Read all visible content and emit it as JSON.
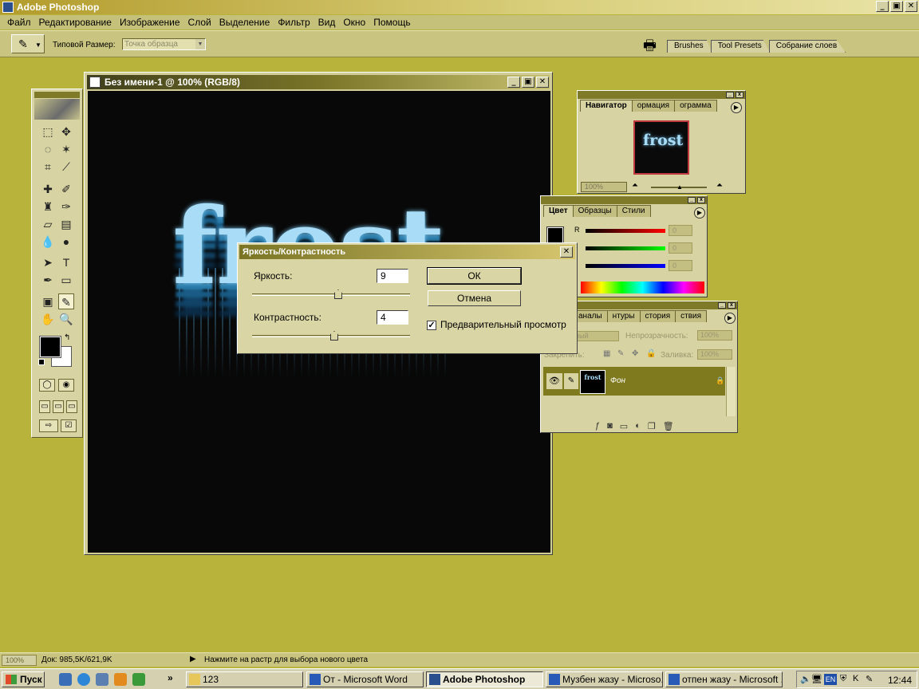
{
  "app": {
    "title": "Adobe Photoshop"
  },
  "window_controls": {
    "minimize": "_",
    "restore": "▣",
    "close": "✕"
  },
  "menu": [
    "Файл",
    "Редактирование",
    "Изображение",
    "Слой",
    "Выделение",
    "Фильтр",
    "Вид",
    "Окно",
    "Помощь"
  ],
  "options_bar": {
    "sample_size_label": "Типовой Размер:",
    "sample_size_value": "Точка образца",
    "palette_well_tabs": [
      "Brushes",
      "Tool Presets",
      "Собрание слоев"
    ]
  },
  "toolbox": {
    "icons": [
      "marquee-icon",
      "move-icon",
      "lasso-icon",
      "magic-wand-icon",
      "crop-icon",
      "slice-icon",
      "healing-icon",
      "brush-icon",
      "stamp-icon",
      "history-brush-icon",
      "eraser-icon",
      "gradient-icon",
      "blur-icon",
      "dodge-icon",
      "path-select-icon",
      "type-icon",
      "pen-icon",
      "shape-icon",
      "notes-icon",
      "eyedropper-icon",
      "hand-icon",
      "zoom-icon"
    ],
    "active_tool": "eyedropper-icon",
    "foreground_color": "#000000",
    "background_color": "#ffffff"
  },
  "document": {
    "title": "Без имени-1 @ 100% (RGB/8)",
    "artwork_text": "frost"
  },
  "navigator": {
    "tabs": [
      "Навигатор",
      "ормация",
      "ограмма"
    ],
    "zoom": "100%",
    "thumb_text": "frost"
  },
  "color_palette": {
    "tabs": [
      "Цвет",
      "Образцы",
      "Стили"
    ],
    "r_label": "R",
    "r_value": "0",
    "g_value": "0",
    "b_value": "0"
  },
  "layers_palette": {
    "tabs": [
      "аналы",
      "нтуры",
      "стория",
      "ствия"
    ],
    "blend_mode": "ный",
    "opacity_label": "Непрозрачность:",
    "opacity_value": "100%",
    "lock_label": "Закрепить:",
    "fill_label": "Заливка:",
    "fill_value": "100%",
    "layer_name": "Фон",
    "layer_thumb_text": "frost"
  },
  "dialog": {
    "title": "Яркость/Контрастность",
    "brightness_label": "Яркость:",
    "brightness_value": "9",
    "contrast_label": "Контрастность:",
    "contrast_value": "4",
    "brightness_level": 9,
    "contrast_level": 4,
    "ok_label": "ОК",
    "cancel_label": "Отмена",
    "preview_label": "Предварительный просмотр",
    "preview_checked": true
  },
  "status_bar": {
    "zoom": "100%",
    "doc_info": "Док: 985,5K/621,9K",
    "hint": "Нажмите на растр для выбора нового цвета"
  },
  "taskbar": {
    "start_label": "Пуск",
    "more": "»",
    "buttons": [
      {
        "label": "123",
        "active": false
      },
      {
        "label": "От - Microsoft Word",
        "active": false
      },
      {
        "label": "Adobe Photoshop",
        "active": true
      },
      {
        "label": "Музбен жазу - Microso...",
        "active": false
      },
      {
        "label": "отпен жазу - Microsoft ...",
        "active": false
      }
    ],
    "language": "EN",
    "clock": "12:44"
  }
}
